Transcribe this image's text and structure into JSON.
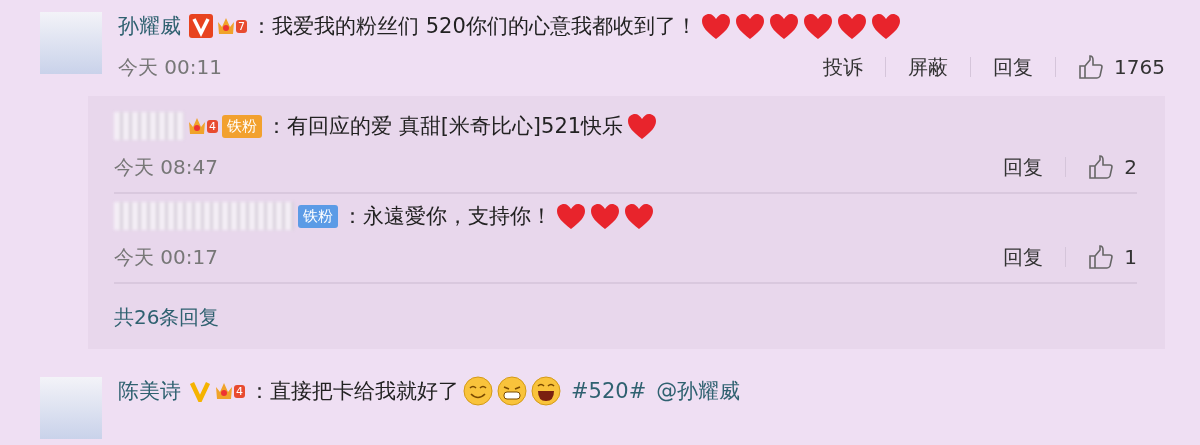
{
  "comments": [
    {
      "user": {
        "name": "孙耀威",
        "v_badge": {
          "kind": "boxed",
          "color": "#e8431f"
        },
        "level_badge": "7"
      },
      "text": "：我爱我的粉丝们 520你们的心意我都收到了！",
      "emojis": [
        {
          "kind": "heart"
        },
        {
          "kind": "heart"
        },
        {
          "kind": "heart"
        },
        {
          "kind": "heart"
        },
        {
          "kind": "heart"
        },
        {
          "kind": "heart"
        }
      ],
      "time": "今天 00:11",
      "actions": [
        "投诉",
        "屏蔽",
        "回复"
      ],
      "likes": "1765",
      "replies": [
        {
          "fan_badge": {
            "label": "铁粉",
            "crown": true,
            "level": "4",
            "color": "#f2a12e"
          },
          "text": "：有回应的爱 真甜[米奇比心]521快乐",
          "emojis": [
            {
              "kind": "heart"
            }
          ],
          "time": "今天 08:47",
          "actions": [
            "回复"
          ],
          "likes": "2"
        },
        {
          "fan_badge": {
            "label": "铁粉",
            "crown": false,
            "color": "#5b9be6"
          },
          "text": "：永遠愛你，支持你！",
          "emojis": [
            {
              "kind": "heart"
            },
            {
              "kind": "heart"
            },
            {
              "kind": "heart"
            }
          ],
          "time": "今天 00:17",
          "actions": [
            "回复"
          ],
          "likes": "1"
        }
      ],
      "more_replies": "共26条回复"
    },
    {
      "user": {
        "name": "陈美诗",
        "v_badge": {
          "kind": "plain",
          "color": "#f5b300"
        },
        "level_badge": "4"
      },
      "text": "：直接把卡给我就好了",
      "emojis": [
        {
          "kind": "smile"
        },
        {
          "kind": "grin"
        },
        {
          "kind": "laugh"
        }
      ],
      "tags": [
        "#520#",
        "@孙耀威"
      ]
    }
  ]
}
